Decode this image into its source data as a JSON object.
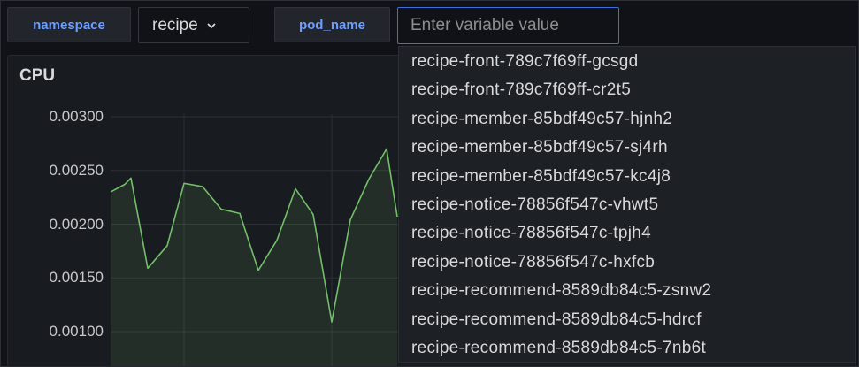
{
  "variables": {
    "namespace": {
      "label": "namespace",
      "value": "recipe"
    },
    "pod_name": {
      "label": "pod_name",
      "placeholder": "Enter variable value"
    }
  },
  "panel": {
    "title": "CPU",
    "chevron_icon": "chevron-down-icon"
  },
  "chart_data": {
    "type": "line",
    "title": "CPU",
    "y_ticks": [
      "0.00300",
      "0.00250",
      "0.00200",
      "0.00150",
      "0.00100"
    ],
    "ylim": [
      0.00072,
      0.00307
    ],
    "grid": true,
    "series": [
      {
        "color": "#73bf69",
        "values": [
          0.0023,
          0.00237,
          0.00243,
          0.00159,
          0.0018,
          0.00238,
          0.00235,
          0.00214,
          0.0021,
          0.00157,
          0.00185,
          0.00233,
          0.00209,
          0.00109,
          0.00204,
          0.00242,
          0.0027,
          0.00207
        ]
      }
    ]
  },
  "dropdown": {
    "options": [
      "recipe-front-789c7f69ff-gcsgd",
      "recipe-front-789c7f69ff-cr2t5",
      "recipe-member-85bdf49c57-hjnh2",
      "recipe-member-85bdf49c57-sj4rh",
      "recipe-member-85bdf49c57-kc4j8",
      "recipe-notice-78856f547c-vhwt5",
      "recipe-notice-78856f547c-tpjh4",
      "recipe-notice-78856f547c-hxfcb",
      "recipe-recommend-8589db84c5-zsnw2",
      "recipe-recommend-8589db84c5-hdrcf",
      "recipe-recommend-8589db84c5-7nb6t"
    ]
  }
}
